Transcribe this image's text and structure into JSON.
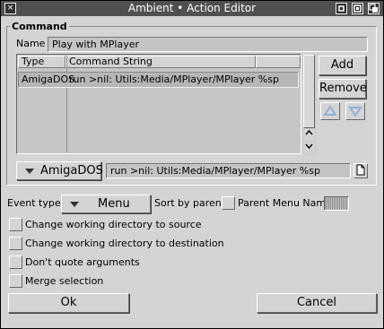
{
  "window": {
    "title": "Ambient • Action Editor",
    "close_glyph": "×"
  },
  "group": {
    "title": "Command"
  },
  "name_field": {
    "label": "Name :",
    "value": "Play with MPlayer"
  },
  "list": {
    "columns": [
      "Type",
      "Command String"
    ],
    "rows": [
      {
        "type": "AmigaDOS",
        "command": "run >nil: Utils:Media/MPlayer/MPlayer %sp"
      }
    ]
  },
  "side_buttons": {
    "add": "Add",
    "remove": "Remove"
  },
  "type_cycle": {
    "value": "AmigaDOS"
  },
  "command_field": {
    "value": "run >nil: Utils:Media/MPlayer/MPlayer %sp"
  },
  "event": {
    "label": "Event type:",
    "value": "Menu",
    "sort_label": "Sort by parent",
    "parent_label": "Parent Menu Name"
  },
  "options": [
    {
      "label": "Change working directory to source",
      "checked": false
    },
    {
      "label": "Change working directory to destination",
      "checked": false
    },
    {
      "label": "Don't quote arguments",
      "checked": false
    },
    {
      "label": "Merge selection",
      "checked": false
    }
  ],
  "footer": {
    "ok": "Ok",
    "cancel": "Cancel"
  },
  "colors": {
    "titlebar": "#505050",
    "window": "#d4d4d4",
    "field": "#c4c4c4",
    "arrow_blue": "#8fb0d8"
  }
}
